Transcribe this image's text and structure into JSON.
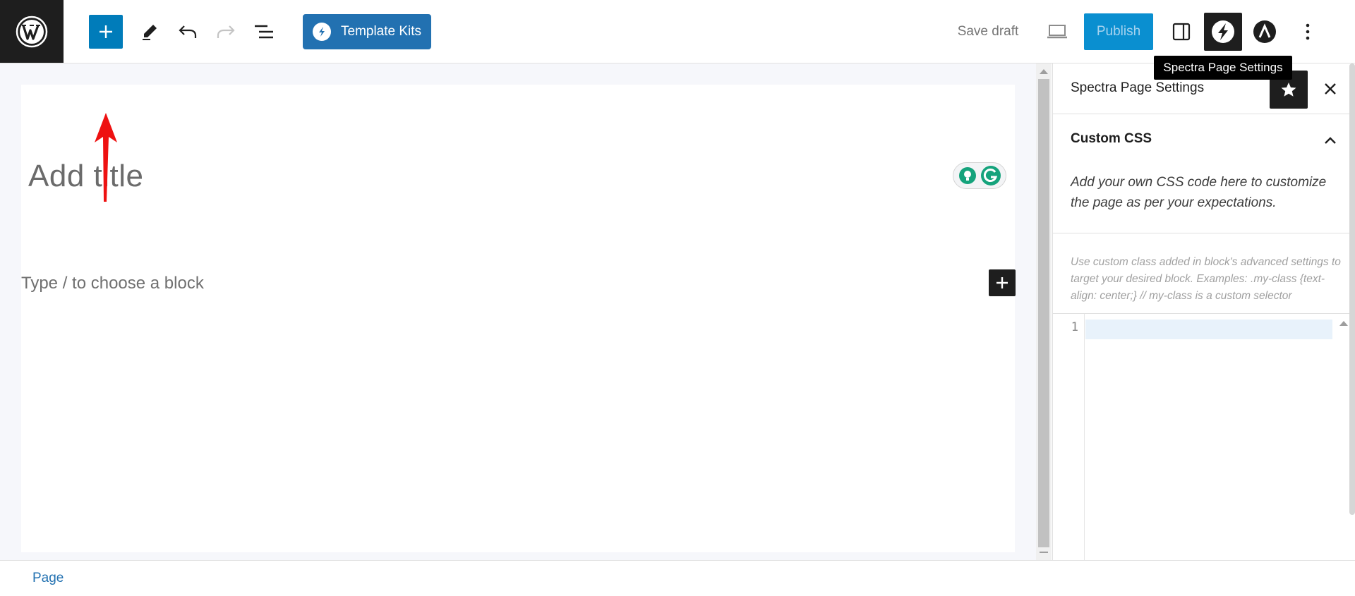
{
  "toolbar": {
    "template_kits_label": "Template Kits",
    "save_draft_label": "Save draft",
    "publish_label": "Publish"
  },
  "tooltip": {
    "text": "Spectra Page Settings"
  },
  "editor": {
    "title_placeholder": "Add title",
    "block_placeholder": "Type / to choose a block"
  },
  "sidebar": {
    "title": "Spectra Page Settings",
    "panel": {
      "title": "Custom CSS",
      "expanded": true,
      "description": "Add your own CSS code here to customize the page as per your expectations.",
      "help_text": "Use custom class added in block's advanced settings to target your desired block. Examples: .my-class {text-align: center;} // my-class is a custom selector",
      "code_line_number": "1"
    }
  },
  "footer": {
    "breadcrumb_label": "Page"
  },
  "colors": {
    "primary": "#007cba",
    "template_kits_bg": "#2271b1",
    "publish_bg": "#0a8fd0",
    "annotation_arrow": "#ee1111",
    "grammarly_green": "#15a37c"
  },
  "icons": [
    "wordpress-logo-icon",
    "plus-icon",
    "pencil-icon",
    "undo-icon",
    "redo-icon",
    "list-view-icon",
    "spectra-icon",
    "laptop-icon",
    "sidebar-icon",
    "astra-icon",
    "more-vertical-icon",
    "star-icon",
    "close-icon",
    "chevron-up-icon",
    "grammarly-bulb-icon",
    "grammarly-g-icon"
  ]
}
